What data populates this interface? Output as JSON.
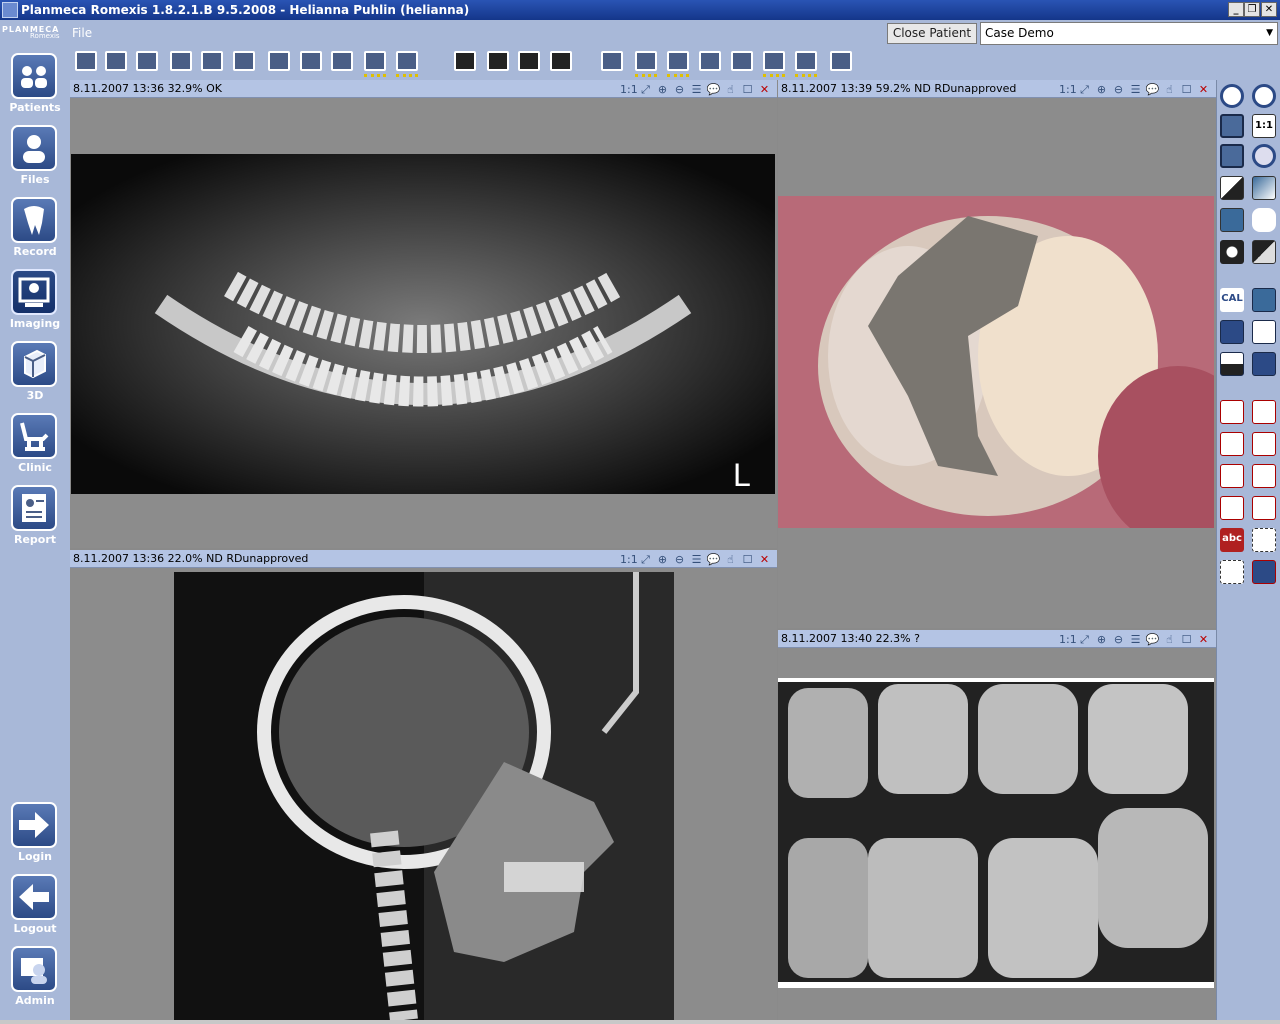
{
  "window": {
    "title": "Planmeca Romexis 1.8.2.1.B  9.5.2008 - Helianna Puhlin (helianna)"
  },
  "branding": {
    "brand": "PLANMECA",
    "product": "Romexis"
  },
  "menu": {
    "file_label": "File"
  },
  "patient": {
    "close_label": "Close Patient",
    "case_value": "Case Demo"
  },
  "nav": {
    "top": [
      {
        "label": "Patients",
        "icon": "patients-icon"
      },
      {
        "label": "Files",
        "icon": "files-icon"
      },
      {
        "label": "Record",
        "icon": "tooth-record-icon"
      },
      {
        "label": "Imaging",
        "icon": "imaging-icon"
      },
      {
        "label": "3D",
        "icon": "3d-cube-icon"
      },
      {
        "label": "Clinic",
        "icon": "dental-chair-icon"
      },
      {
        "label": "Report",
        "icon": "report-icon"
      }
    ],
    "bottom": [
      {
        "label": "Login",
        "icon": "login-arrow-icon"
      },
      {
        "label": "Logout",
        "icon": "logout-arrow-icon"
      },
      {
        "label": "Admin",
        "icon": "admin-icon"
      }
    ]
  },
  "panes": {
    "pano": {
      "header": "8.11.2007 13:36 32.9% OK",
      "marker": "L"
    },
    "intraoral": {
      "header": "8.11.2007 13:39 59.2% ND RDunapproved"
    },
    "ceph": {
      "header": "8.11.2007 13:36 22.0% ND RDunapproved"
    },
    "bitewing": {
      "header": "8.11.2007 13:40 22.3% ?"
    }
  },
  "pane_tools": {
    "one_to_one": "1:1",
    "fit": "⤢",
    "zoom_in": "⊕",
    "zoom_out": "⊖",
    "list": "☰",
    "comment": "💬",
    "hand": "☝",
    "maximize": "☐",
    "close": "✕"
  },
  "right_tools": {
    "cal": "CAL",
    "one_to_one": "1:1",
    "abc": "abc"
  },
  "colors": {
    "panel": "#a8b8d8",
    "header": "#b4c4e4",
    "title": "#1a3c96"
  }
}
